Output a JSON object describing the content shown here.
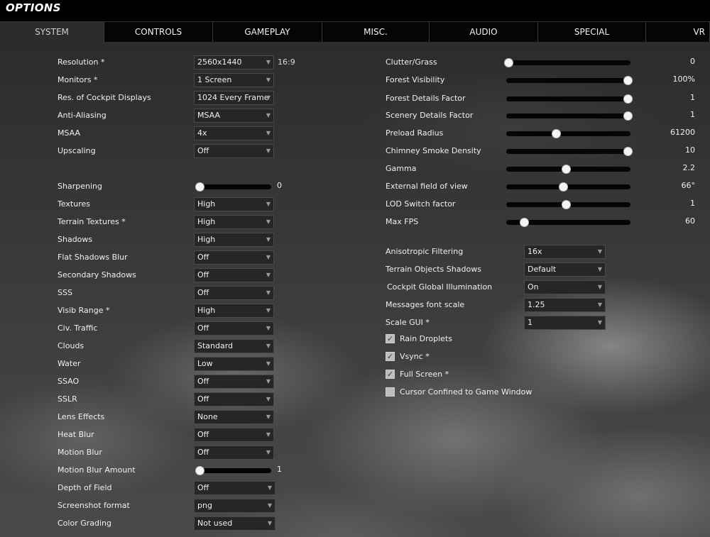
{
  "window": {
    "title": "OPTIONS"
  },
  "tabs": [
    "SYSTEM",
    "CONTROLS",
    "GAMEPLAY",
    "MISC.",
    "AUDIO",
    "SPECIAL",
    "VR"
  ],
  "active_tab": "SYSTEM",
  "left": {
    "resolution": {
      "label": "Resolution *",
      "value": "2560x1440",
      "aspect": "16:9"
    },
    "monitors": {
      "label": "Monitors *",
      "value": "1 Screen"
    },
    "cockpit_displays": {
      "label": "Res. of Cockpit Displays",
      "value": "1024 Every Frame"
    },
    "anti_aliasing": {
      "label": "Anti-Aliasing",
      "value": "MSAA"
    },
    "msaa": {
      "label": "MSAA",
      "value": "4x"
    },
    "upscaling": {
      "label": "Upscaling",
      "value": "Off"
    },
    "sharpening": {
      "label": "Sharpening",
      "value": "0",
      "level": 0
    },
    "textures": {
      "label": "Textures",
      "value": "High"
    },
    "terrain_textures": {
      "label": "Terrain Textures *",
      "value": "High"
    },
    "shadows": {
      "label": "Shadows",
      "value": "High"
    },
    "flat_shadows_blur": {
      "label": "Flat Shadows Blur",
      "value": "Off"
    },
    "secondary_shadows": {
      "label": "Secondary Shadows",
      "value": "Off"
    },
    "sss": {
      "label": "SSS",
      "value": "Off"
    },
    "visib_range": {
      "label": "Visib Range *",
      "value": "High"
    },
    "civ_traffic": {
      "label": "Civ. Traffic",
      "value": "Off"
    },
    "clouds": {
      "label": "Clouds",
      "value": "Standard"
    },
    "water": {
      "label": "Water",
      "value": "Low"
    },
    "ssao": {
      "label": "SSAO",
      "value": "Off"
    },
    "sslr": {
      "label": "SSLR",
      "value": "Off"
    },
    "lens_effects": {
      "label": "Lens Effects",
      "value": "None"
    },
    "heat_blur": {
      "label": "Heat Blur",
      "value": "Off"
    },
    "motion_blur": {
      "label": "Motion Blur",
      "value": "Off"
    },
    "motion_blur_amount": {
      "label": "Motion Blur Amount",
      "value": "1",
      "level": 0
    },
    "depth_of_field": {
      "label": "Depth of Field",
      "value": "Off"
    },
    "screenshot_format": {
      "label": "Screenshot format",
      "value": "png"
    },
    "color_grading": {
      "label": "Color Grading",
      "value": "Not used"
    }
  },
  "right": {
    "clutter_grass": {
      "label": "Clutter/Grass",
      "value": "0",
      "level": 0.0
    },
    "forest_visibility": {
      "label": "Forest Visibility",
      "value": "100%",
      "level": 1.0
    },
    "forest_details": {
      "label": "Forest Details Factor",
      "value": "1",
      "level": 1.0
    },
    "scenery_details": {
      "label": "Scenery Details Factor",
      "value": "1",
      "level": 1.0
    },
    "preload_radius": {
      "label": "Preload Radius",
      "value": "61200",
      "level": 0.4
    },
    "chimney_smoke": {
      "label": "Chimney Smoke Density",
      "value": "10",
      "level": 1.0
    },
    "gamma": {
      "label": "Gamma",
      "value": "2.2",
      "level": 0.48
    },
    "external_fov": {
      "label": "External field of view",
      "value": "66°",
      "level": 0.46
    },
    "lod_switch": {
      "label": "LOD Switch factor",
      "value": "1",
      "level": 0.48
    },
    "max_fps": {
      "label": "Max FPS",
      "value": "60",
      "level": 0.13
    },
    "anisotropic": {
      "label": "Anisotropic Filtering",
      "value": "16x"
    },
    "terrain_objects_shadows": {
      "label": "Terrain Objects Shadows",
      "value": "Default"
    },
    "cockpit_gi": {
      "label": "Cockpit Global Illumination",
      "value": "On"
    },
    "messages_font_scale": {
      "label": "Messages font scale",
      "value": "1.25"
    },
    "scale_gui": {
      "label": "Scale GUI *",
      "value": "1"
    },
    "rain_droplets": {
      "label": "Rain Droplets",
      "checked": true
    },
    "vsync": {
      "label": "Vsync *",
      "checked": true
    },
    "full_screen": {
      "label": "Full Screen *",
      "checked": true
    },
    "cursor_confined": {
      "label": "Cursor Confined to Game Window",
      "checked": false
    }
  }
}
